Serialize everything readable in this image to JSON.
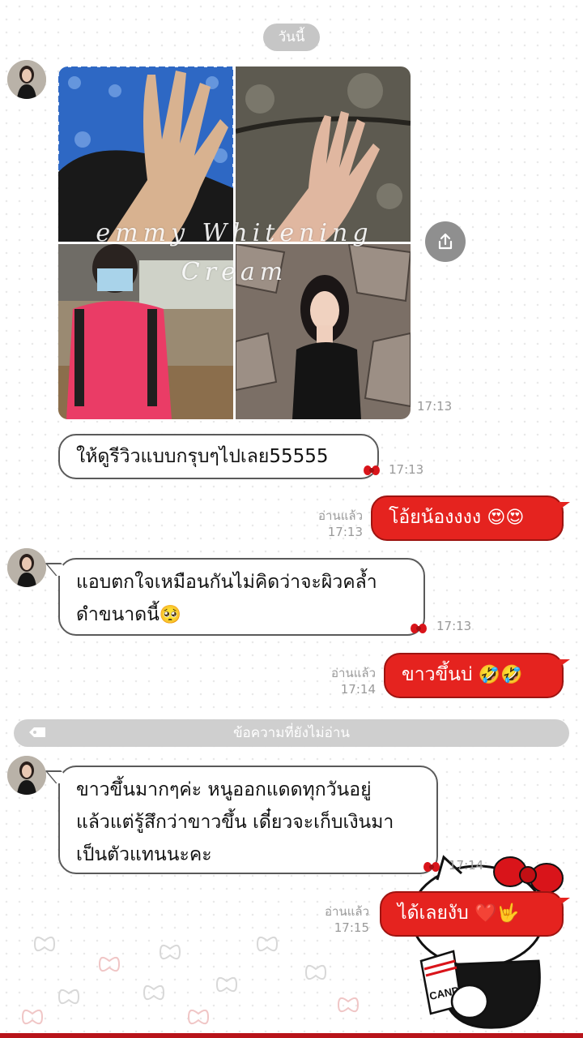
{
  "header": {
    "date_label": "วันนี้"
  },
  "collage": {
    "watermark_line1": "emmy Whitening",
    "watermark_line2": "Cream"
  },
  "messages": [
    {
      "time": "17:13"
    },
    {
      "text": "ให้ดูรีวิวแบบกรุบๆไปเลย55555",
      "time": "17:13"
    },
    {
      "text": "โอ้ยน้องงงง",
      "emoji": "😍😍",
      "read_label": "อ่านแล้ว",
      "time": "17:13"
    },
    {
      "line1": "แอบตกใจเหมือนกันไม่คิดว่าจะผิวคล้ำ",
      "line2": "ดำขนาดนี้",
      "emoji": "🥺",
      "time": "17:13"
    },
    {
      "text": "ขาวขึ้นบ่",
      "emoji": "🤣🤣",
      "read_label": "อ่านแล้ว",
      "time": "17:14"
    },
    {
      "line1": "ขาวขึ้นมากๆค่ะ หนูออกแดดทุกวันอยู่",
      "line2": "แล้วแต่รู้สึกว่าขาวขึ้น เดี๋ยวจะเก็บเงินมา",
      "line3": "เป็นตัวแทนนะคะ",
      "time": "17:14"
    },
    {
      "text": "ได้เลยงับ",
      "emoji": "❤️🤟",
      "read_label": "อ่านแล้ว",
      "time": "17:15"
    }
  ],
  "unread_divider": "ข้อความที่ยังไม่อ่าน",
  "sticker": {
    "label": "CANDY"
  },
  "colors": {
    "accent_red": "#e5231f",
    "bubble_border": "#5a5a5a",
    "divider_gray": "#cfcfcf"
  }
}
